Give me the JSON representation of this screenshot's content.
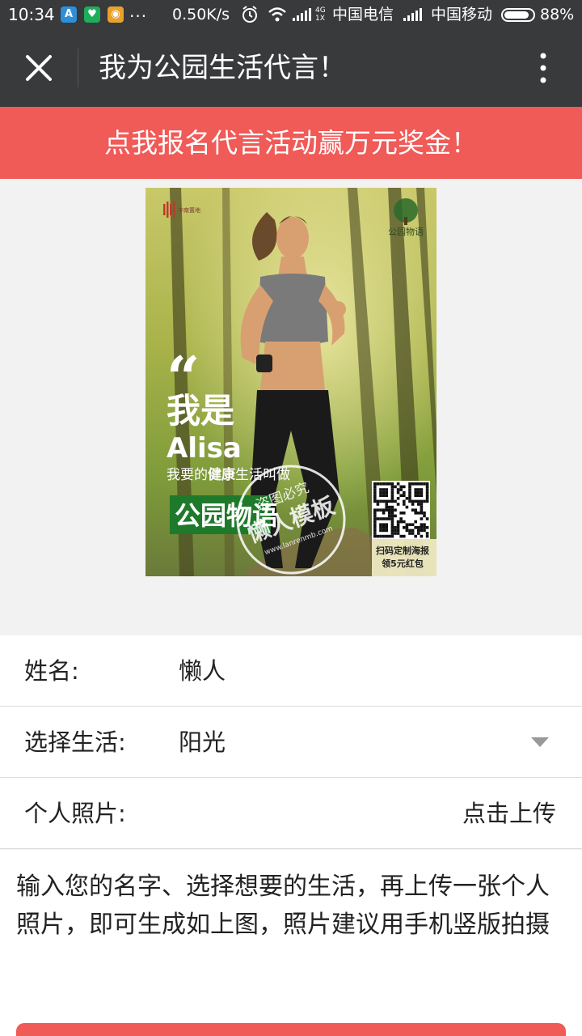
{
  "status_bar": {
    "time": "10:34",
    "apps": [
      "A",
      "♥",
      "◉"
    ],
    "more": "...",
    "speed": "0.50K/s",
    "network": "4G\n1X",
    "net_top": "4G",
    "net_bottom": "1X",
    "carrier1": "中国电信",
    "carrier2": "中国移动",
    "battery": "88%",
    "battery_level": 0.88
  },
  "nav": {
    "title": "我为公园生活代言！"
  },
  "promo": {
    "text": "点我报名代言活动赢万元奖金！"
  },
  "poster": {
    "brand_left": "中南置地",
    "brand_right": "公园物语",
    "quote_mark": "“",
    "line1": "我是",
    "name": "Alisa",
    "line2_prefix": "我要的",
    "line2_highlight": "健康",
    "line2_suffix": "生活叫做",
    "slogan": "公园物语",
    "qr_line1": "扫码定制海报",
    "qr_line2": "领5元红包",
    "watermark_top": "盗图必究",
    "watermark_main": "懒人模板",
    "watermark_url": "www.lanrenmb.com"
  },
  "form": {
    "name_label": "姓名:",
    "name_value": "懒人",
    "life_label": "选择生活:",
    "life_value": "阳光",
    "photo_label": "个人照片:",
    "photo_action": "点击上传"
  },
  "description": "输入您的名字、选择想要的生活，再上传一张个人照片，即可生成如上图，照片建议用手机竖版拍摄",
  "colors": {
    "header_bg": "#383a3c",
    "accent_red": "#f05a57",
    "poster_green": "#1e7a2a"
  }
}
